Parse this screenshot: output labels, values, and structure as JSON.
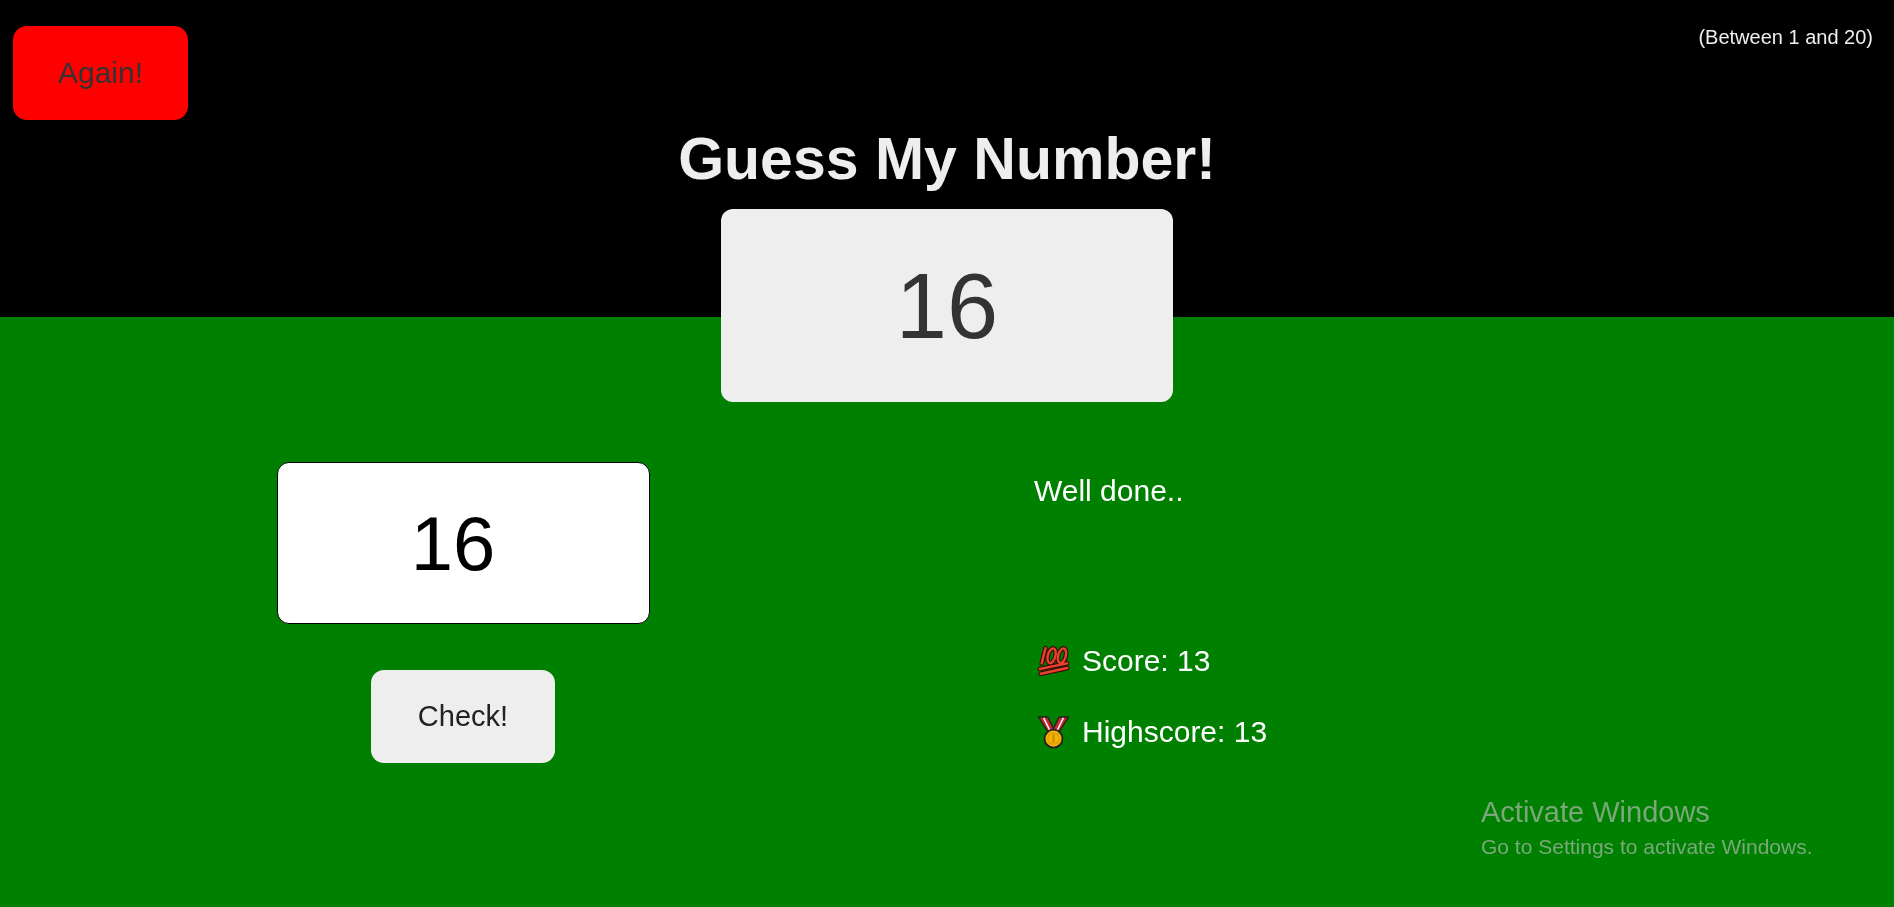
{
  "won": true,
  "header": {
    "again_button": "Again!",
    "range_hint": "(Between 1 and 20)",
    "title": "Guess My Number!",
    "secret_number": "16"
  },
  "guess": {
    "input_value": "16",
    "check_button": "Check!"
  },
  "message": "Well done..",
  "stats": [
    {
      "kind": "score",
      "label": "Score: 13"
    },
    {
      "kind": "highscore",
      "label": "Highscore: 13"
    }
  ],
  "os_notice": {
    "title": "Activate Windows",
    "subtitle": "Go to Settings to activate Windows."
  }
}
